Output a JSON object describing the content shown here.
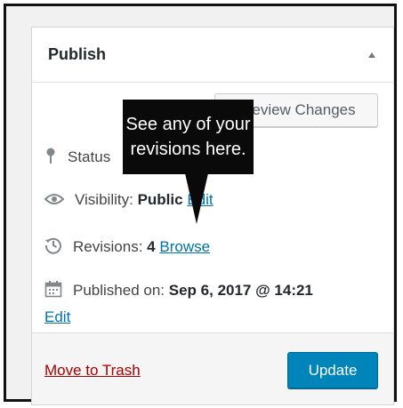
{
  "panel": {
    "title": "Publish",
    "preview_button": "Preview Changes",
    "status_label": "Status",
    "visibility_label": "Visibility:",
    "visibility_value": "Public",
    "visibility_edit": "Edit",
    "revisions_label": "Revisions:",
    "revisions_count": "4",
    "revisions_browse": "Browse",
    "published_label": "Published on:",
    "published_value": "Sep 6, 2017 @ 14:21",
    "published_edit": "Edit",
    "trash_link": "Move to Trash",
    "update_button": "Update"
  },
  "callout": {
    "line1": "See any of your",
    "line2": "revisions here."
  },
  "icons": {
    "status": "pin-icon",
    "visibility": "eye-icon",
    "revisions": "history-clock-icon",
    "published": "calendar-icon",
    "toggle": "caret-up-icon"
  },
  "colors": {
    "link": "#0073aa",
    "trash": "#aa0000",
    "update_button": "#0085ba",
    "callout_bg": "#0a0a0a"
  }
}
